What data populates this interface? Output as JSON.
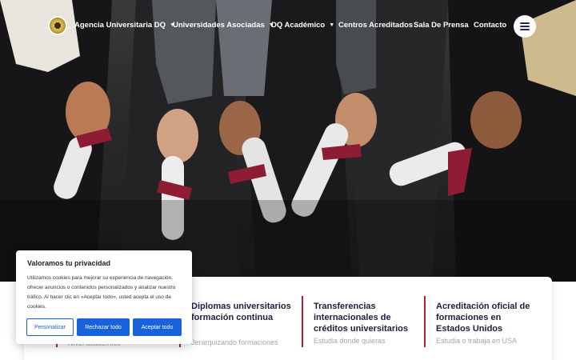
{
  "nav": {
    "items": [
      {
        "label": "Agencia Universitaria DQ",
        "dropdown": true
      },
      {
        "label": "Universidades Asociadas",
        "dropdown": true
      },
      {
        "label": "DQ Académico",
        "dropdown": true
      },
      {
        "label": "Centros Acreditados",
        "dropdown": false
      },
      {
        "label": "Sala De Prensa",
        "dropdown": false
      },
      {
        "label": "Contacto",
        "dropdown": false
      }
    ]
  },
  "cards": [
    {
      "title": "",
      "subtitle": "Nivel académico"
    },
    {
      "title": "Diplomas universitarios formación continua",
      "subtitle": "Jerarquizando formaciones"
    },
    {
      "title": "Transferencias internacionales de créditos universitarios",
      "subtitle": "Estudia donde quieras"
    },
    {
      "title": "Acreditación oficial de formaciones en Estados Unidos",
      "subtitle": "Estudia o trabaja en USA"
    }
  ],
  "cookie": {
    "title": "Valoramos tu privacidad",
    "text": "Utilizamos cookies para mejorar su experiencia de navegación, ofrecer anuncios o contenidos personalizados y analizar nuestro tráfico. Al hacer clic en «Aceptar todo», usted acepta el uso de cookies.",
    "customize": "Personalizar",
    "reject": "Rechazar todo",
    "accept": "Aceptar todo"
  },
  "colors": {
    "accent": "#1863dc",
    "card_bar": "#b51e2c",
    "heading": "#1b1f3b"
  }
}
